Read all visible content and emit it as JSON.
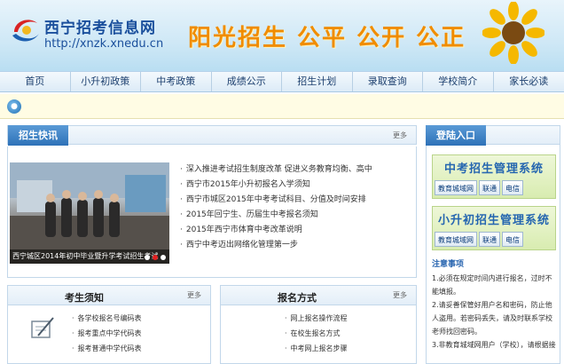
{
  "header": {
    "site_name": "西宁招考信息网",
    "site_url": "http://xnzk.xnedu.cn",
    "slogan": "阳光招生 公平 公开 公正"
  },
  "nav": [
    "首页",
    "小升初政策",
    "中考政策",
    "成绩公示",
    "招生计划",
    "录取查询",
    "学校简介",
    "家长必读"
  ],
  "news": {
    "title": "招生快讯",
    "more": "更多",
    "photo_caption": "西宁城区2014年初中毕业暨升学考试招生考试",
    "items": [
      "深入推进考试招生制度改革 促进义务教育均衡、高中",
      "西宁市2015年小升初报名入学须知",
      "西宁市城区2015年中考考试科目、分值及时间安排",
      "2015年回宁生、历届生中考报名须知",
      "2015年西宁市体育中考改革说明",
      "西宁中考迈出网络化管理第一步"
    ]
  },
  "login": {
    "title": "登陆入口",
    "zhongkao_title": "中考招生管理系统",
    "xiaoshengchu_title": "小升初招生管理系统",
    "buttons": [
      "教育城域网",
      "联通",
      "电信"
    ],
    "notice_title": "注意事项",
    "notice_lines": [
      "1.必须在规定时间内进行报名，过时不能填报。",
      "2.请妥善保管好用户名和密码，防止他人盗用。若密码丢失，请及时联系学校老师找回密码。",
      "3.非教育城域网用户（学校），请根据接"
    ]
  },
  "exam_notice": {
    "title": "考生须知",
    "more": "更多",
    "items": [
      "各学校报名号编码表",
      "报考重点中学代码表",
      "报考普通中学代码表"
    ]
  },
  "enroll": {
    "title": "报名方式",
    "more": "更多",
    "items": [
      "网上报名操作流程",
      "在校生报名方式",
      "中考网上报名步骤"
    ]
  }
}
